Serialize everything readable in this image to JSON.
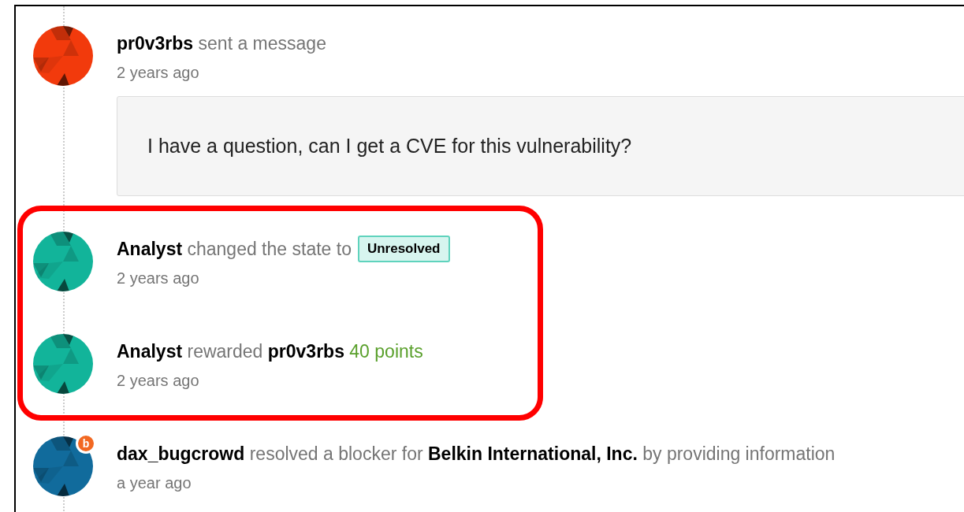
{
  "activity": [
    {
      "avatar": {
        "color": "#f23a0c"
      },
      "headline": [
        {
          "kind": "user",
          "text": "pr0v3rbs"
        },
        {
          "kind": "text",
          "text": "sent a message"
        }
      ],
      "time": "2 years ago",
      "message": "I have a question, can I get a CVE for this vulnerability?",
      "highlighted": false
    },
    {
      "avatar": {
        "color": "#12b49a"
      },
      "headline": [
        {
          "kind": "user",
          "text": "Analyst"
        },
        {
          "kind": "text",
          "text": "changed the state to"
        }
      ],
      "state": "Unresolved",
      "time": "2 years ago",
      "highlighted": true
    },
    {
      "avatar": {
        "color": "#12b49a"
      },
      "headline": [
        {
          "kind": "user",
          "text": "Analyst"
        },
        {
          "kind": "text",
          "text": "rewarded"
        },
        {
          "kind": "user",
          "text": "pr0v3rbs"
        },
        {
          "kind": "points",
          "text": "40 points"
        }
      ],
      "time": "2 years ago",
      "highlighted": true
    },
    {
      "avatar": {
        "color": "#116b9c",
        "badge": "b"
      },
      "headline": [
        {
          "kind": "user",
          "text": "dax_bugcrowd"
        },
        {
          "kind": "text",
          "text": "resolved a blocker for"
        },
        {
          "kind": "org",
          "text": "Belkin International, Inc."
        },
        {
          "kind": "text",
          "text": "by providing information"
        }
      ],
      "time": "a year ago",
      "highlighted": false
    }
  ]
}
